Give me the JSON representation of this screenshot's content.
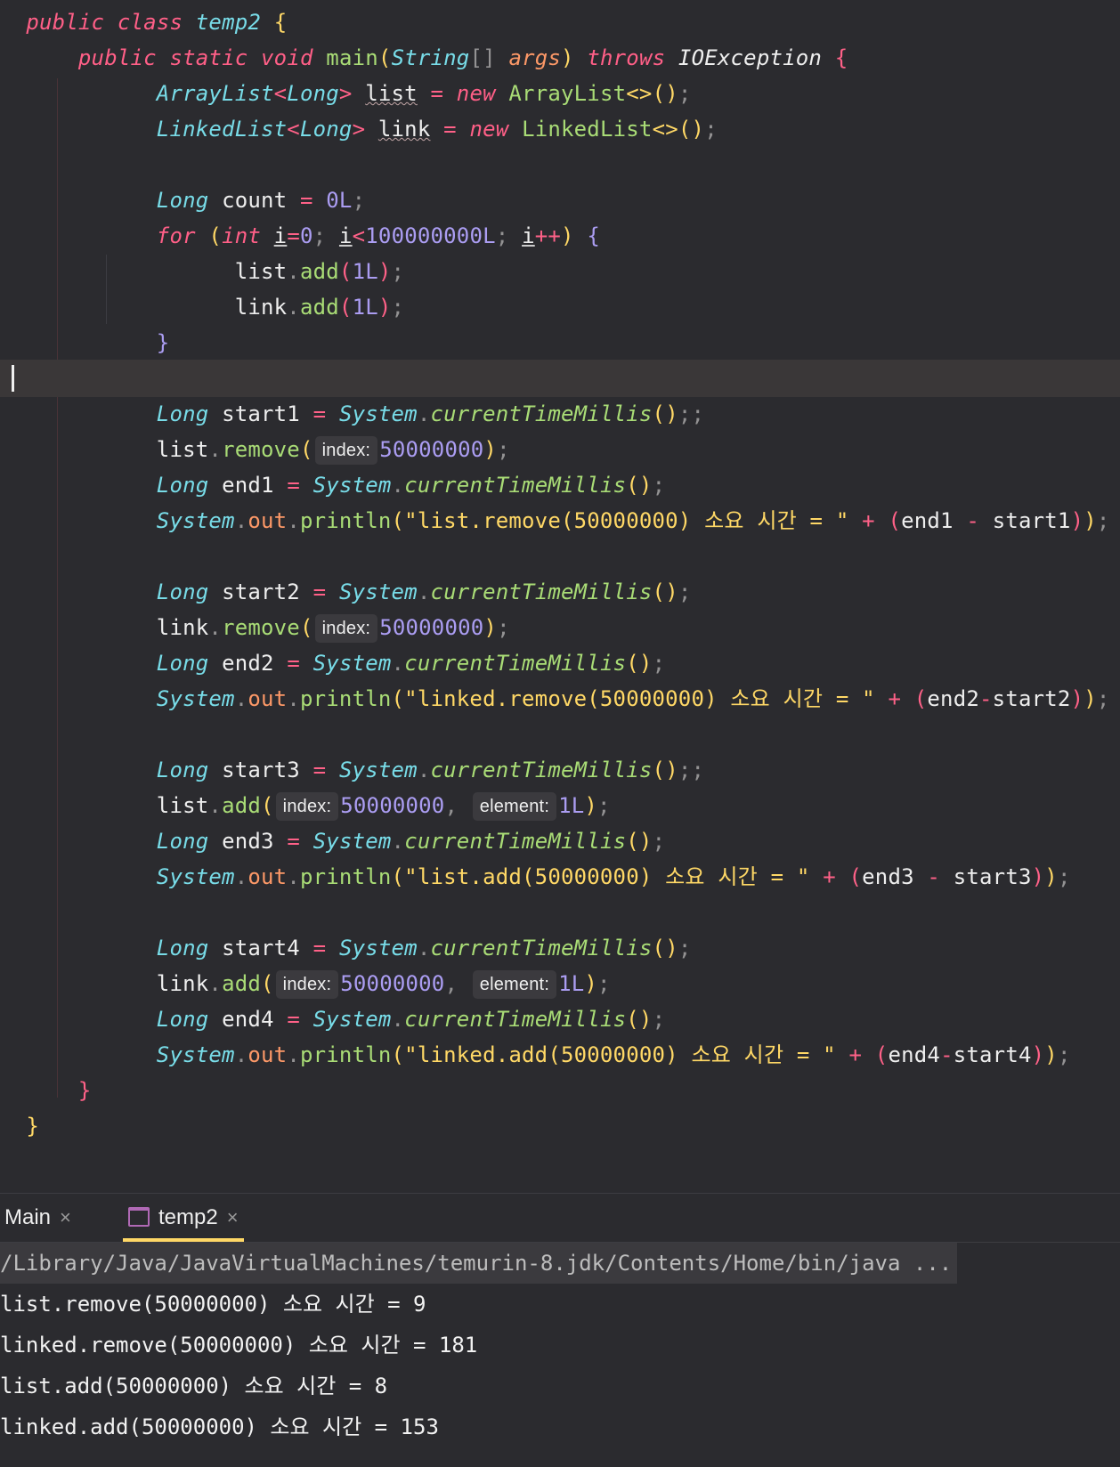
{
  "editor": {
    "line1": {
      "t1": "public",
      "t2": "class",
      "t3": "temp2",
      "t4": "{"
    },
    "line2": {
      "t1": "public",
      "t2": "static",
      "t3": "void",
      "t4": "main",
      "t5": "(",
      "t6": "String",
      "t7": "[]",
      "t8": "args",
      "t9": ")",
      "t10": "throws",
      "t11": "IOException",
      "t12": "{"
    },
    "line3": {
      "t1": "ArrayList",
      "t2": "<",
      "t3": "Long",
      "t4": ">",
      "t5": "list",
      "t6": "=",
      "t7": "new",
      "t8": "ArrayList",
      "t9": "<>",
      "t10": "()",
      "t11": ";"
    },
    "line4": {
      "t1": "LinkedList",
      "t2": "<",
      "t3": "Long",
      "t4": ">",
      "t5": "link",
      "t6": "=",
      "t7": "new",
      "t8": "LinkedList",
      "t9": "<>",
      "t10": "()",
      "t11": ";"
    },
    "line6": {
      "t1": "Long",
      "t2": "count",
      "t3": "=",
      "t4": "0L",
      "t5": ";"
    },
    "line7": {
      "t1": "for",
      "t2": "(",
      "t3": "int",
      "t4": "i",
      "t5": "=",
      "t6": "0",
      "t7": ";",
      "t8": "i",
      "t9": "<",
      "t10": "100000000L",
      "t11": ";",
      "t12": "i",
      "t13": "++",
      "t14": ")",
      "t15": "{"
    },
    "line8": {
      "t1": "list",
      "t2": ".",
      "t3": "add",
      "t4": "(",
      "t5": "1L",
      "t6": ")",
      "t7": ";"
    },
    "line9": {
      "t1": "link",
      "t2": ".",
      "t3": "add",
      "t4": "(",
      "t5": "1L",
      "t6": ")",
      "t7": ";"
    },
    "line10": {
      "t1": "}"
    },
    "block1": {
      "start_type": "Long",
      "start_var": "start1",
      "eq": "=",
      "sys": "System",
      "dot": ".",
      "millis": "currentTimeMillis",
      "parens": "()",
      "semi": ";;",
      "obj": "list",
      "op_fn": "remove",
      "open": "(",
      "hint_index": "index:",
      "index_val": "50000000",
      "close": ")",
      "semi2": ";",
      "end_type": "Long",
      "end_var": "end1",
      "end_semi": ";",
      "print_sys": "System",
      "out": "out",
      "println": "println",
      "print_open": "(",
      "str": "\"list.remove(50000000) 소요 시간 = \"",
      "plus": "+",
      "p_open": "(",
      "a": "end1",
      "minus": "-",
      "b": "start1",
      "p_close": ")",
      "print_close": ")",
      "print_semi": ";"
    },
    "block2": {
      "start_type": "Long",
      "start_var": "start2",
      "eq": "=",
      "sys": "System",
      "dot": ".",
      "millis": "currentTimeMillis",
      "parens": "()",
      "semi": ";",
      "obj": "link",
      "op_fn": "remove",
      "open": "(",
      "hint_index": "index:",
      "index_val": "50000000",
      "close": ")",
      "semi2": ";",
      "end_type": "Long",
      "end_var": "end2",
      "end_semi": ";",
      "print_sys": "System",
      "out": "out",
      "println": "println",
      "print_open": "(",
      "str": "\"linked.remove(50000000) 소요 시간 = \"",
      "plus": "+",
      "p_open": "(",
      "a": "end2",
      "minus": "-",
      "b": "start2",
      "p_close": ")",
      "print_close": ")",
      "print_semi": ";"
    },
    "block3": {
      "start_type": "Long",
      "start_var": "start3",
      "eq": "=",
      "sys": "System",
      "dot": ".",
      "millis": "currentTimeMillis",
      "parens": "()",
      "semi": ";;",
      "obj": "list",
      "op_fn": "add",
      "open": "(",
      "hint_index": "index:",
      "index_val": "50000000",
      "comma": ",",
      "hint_element": "element:",
      "element_val": "1L",
      "close": ")",
      "semi2": ";",
      "end_type": "Long",
      "end_var": "end3",
      "end_semi": ";",
      "print_sys": "System",
      "out": "out",
      "println": "println",
      "print_open": "(",
      "str": "\"list.add(50000000) 소요 시간 = \"",
      "plus": "+",
      "p_open": "(",
      "a": "end3",
      "minus": "-",
      "b": "start3",
      "p_close": ")",
      "print_close": ")",
      "print_semi": ";"
    },
    "block4": {
      "start_type": "Long",
      "start_var": "start4",
      "eq": "=",
      "sys": "System",
      "dot": ".",
      "millis": "currentTimeMillis",
      "parens": "()",
      "semi": ";",
      "obj": "link",
      "op_fn": "add",
      "open": "(",
      "hint_index": "index:",
      "index_val": "50000000",
      "comma": ",",
      "hint_element": "element:",
      "element_val": "1L",
      "close": ")",
      "semi2": ";",
      "end_type": "Long",
      "end_var": "end4",
      "end_semi": ";",
      "print_sys": "System",
      "out": "out",
      "println": "println",
      "print_open": "(",
      "str": "\"linked.add(50000000) 소요 시간 = \"",
      "plus": "+",
      "p_open": "(",
      "a": "end4",
      "minus": "-",
      "b": "start4",
      "p_close": ")",
      "print_close": ")",
      "print_semi": ";"
    },
    "close_method": "}",
    "close_class": "}"
  },
  "tabs": {
    "main_label": "Main",
    "main_close": "×",
    "temp2_label": "temp2",
    "temp2_close": "×"
  },
  "console": {
    "command": "/Library/Java/JavaVirtualMachines/temurin-8.jdk/Contents/Home/bin/java ...",
    "lines": [
      "list.remove(50000000) 소요 시간 = 9",
      "linked.remove(50000000) 소요 시간 = 181",
      "list.add(50000000) 소요 시간 = 8",
      "linked.add(50000000) 소요 시간 = 153"
    ]
  },
  "colors": {
    "background": "#2b2b2f",
    "keyword": "#ff5f87",
    "type": "#78dce8",
    "function": "#a9dc76",
    "number": "#ab9df2",
    "string": "#ffd866",
    "active_tab_underline": "#ffd866"
  }
}
